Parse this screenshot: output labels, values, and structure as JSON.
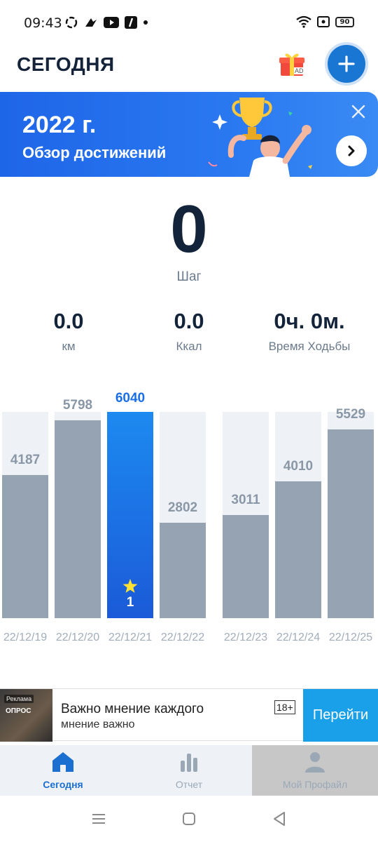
{
  "status_bar": {
    "time": "09:43",
    "battery": "90"
  },
  "header": {
    "title": "СЕГОДНЯ",
    "ad_tag": "AD"
  },
  "banner": {
    "year": "2022 г.",
    "subtitle": "Обзор достижений"
  },
  "steps": {
    "value": "0",
    "label": "Шаг"
  },
  "stats": [
    {
      "value": "0.0",
      "label": "км"
    },
    {
      "value": "0.0",
      "label": "Ккал"
    },
    {
      "value": "0ч. 0м.",
      "label": "Время Ходьбы"
    }
  ],
  "chart_data": {
    "type": "bar",
    "categories": [
      "22/12/19",
      "22/12/20",
      "22/12/21",
      "22/12/22",
      "22/12/23",
      "22/12/24",
      "22/12/25"
    ],
    "values": [
      4187,
      5798,
      6040,
      2802,
      3011,
      4010,
      5529
    ],
    "labels": [
      "4187",
      "5798",
      "6040",
      "2802",
      "3011",
      "4010",
      "5529"
    ],
    "ylim": [
      0,
      6040
    ],
    "highlight_index": 2,
    "highlight_badge": "1",
    "colors": {
      "bar": "#95a3b3",
      "track": "#eef2f6",
      "highlight": "#1a6fe6",
      "label": "#8a97a6",
      "highlight_label": "#1a6fe6",
      "star": "#ffe234"
    }
  },
  "ad": {
    "badge": "Реклама",
    "thumb_text": "ОПРОС",
    "title": "Важно мнение каждого",
    "subtitle": "мнение важно",
    "age": "18+",
    "cta": "Перейти"
  },
  "tabs": [
    {
      "label": "Сегодня",
      "icon": "home-icon",
      "active": true
    },
    {
      "label": "Отчет",
      "icon": "bar-chart-icon",
      "active": false
    },
    {
      "label": "Мой Профайл",
      "icon": "person-icon",
      "active": false
    }
  ],
  "colors": {
    "accent": "#1976d2",
    "tab_active": "#1a6fd0",
    "tab_inactive": "#9aa8b6"
  }
}
